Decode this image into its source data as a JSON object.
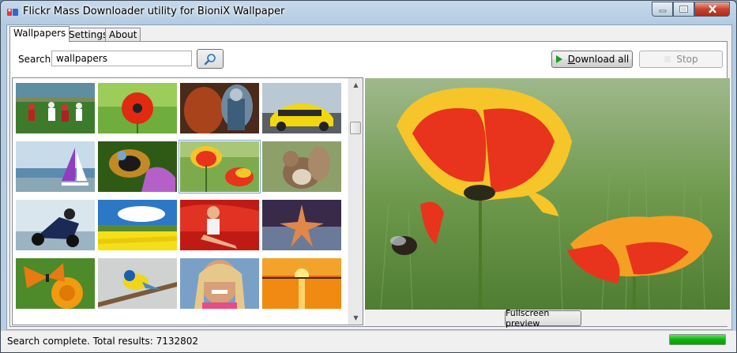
{
  "window": {
    "title": "Flickr Mass Downloader utility for BioniX Wallpaper"
  },
  "tabs": [
    {
      "label": "Wallpapers",
      "active": true
    },
    {
      "label": "Settings",
      "active": false
    },
    {
      "label": "About",
      "active": false
    }
  ],
  "search": {
    "label": "Search:",
    "value": "wallpapers"
  },
  "toolbar": {
    "download_prefix": "D",
    "download_rest": "ownload all",
    "stop_label": "Stop"
  },
  "gallery": {
    "thumbnails": [
      {
        "name": "rugby-match"
      },
      {
        "name": "red-poppy"
      },
      {
        "name": "fantasy-warrior"
      },
      {
        "name": "yellow-ferrari"
      },
      {
        "name": "sailboat"
      },
      {
        "name": "bee-on-flower"
      },
      {
        "name": "poppies-field",
        "selected": true
      },
      {
        "name": "squirrel"
      },
      {
        "name": "motorcycle-racer"
      },
      {
        "name": "rapeseed-field"
      },
      {
        "name": "woman-with-red-car"
      },
      {
        "name": "starfish"
      },
      {
        "name": "butterfly-on-marigold"
      },
      {
        "name": "blue-tit-bird"
      },
      {
        "name": "smiling-woman"
      },
      {
        "name": "sunset-over-water"
      }
    ]
  },
  "preview": {
    "subject": "poppies with bumblebee",
    "fullscreen_label": "Fullscreen preview"
  },
  "status": {
    "text": "Search complete. Total results: 7132802",
    "progress_fraction": 1.0
  },
  "colors": {
    "accent_green": "#10b010",
    "poppy_red": "#e8341c",
    "poppy_yellow": "#f5c52a"
  }
}
